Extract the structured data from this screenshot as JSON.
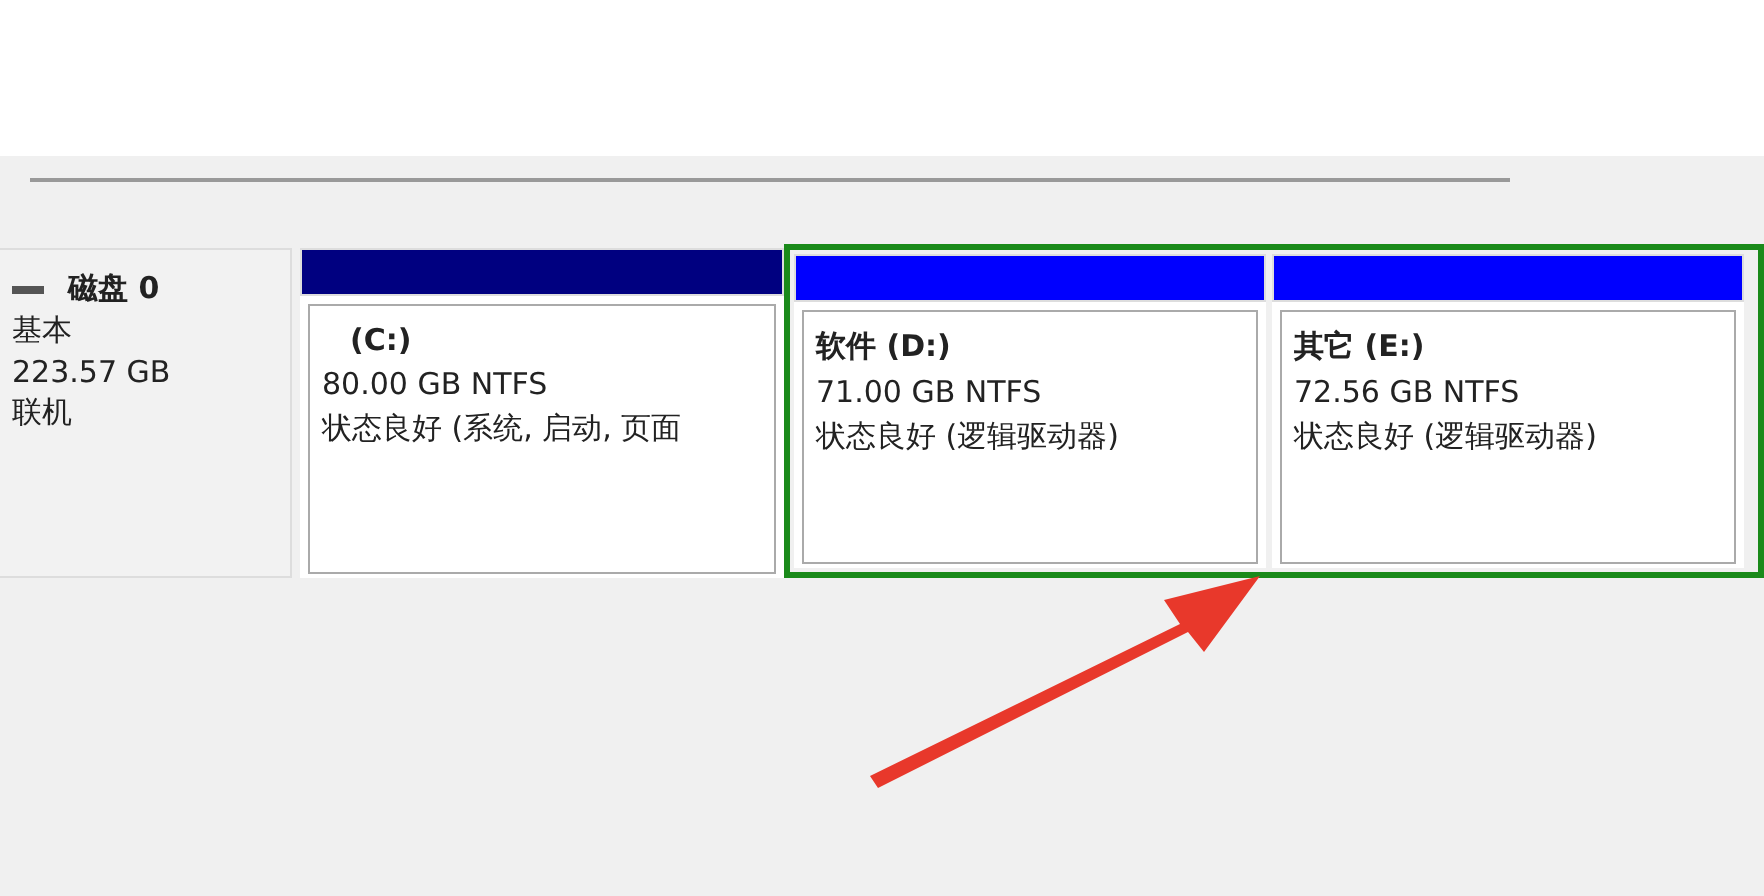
{
  "disk": {
    "name": "磁盘 0",
    "type": "基本",
    "size": "223.57 GB",
    "status": "联机"
  },
  "partitions": [
    {
      "kind": "primary",
      "label": "(C:)",
      "size": "80.00 GB NTFS",
      "status": "状态良好 (系统, 启动, 页面"
    }
  ],
  "extended": {
    "selected": true,
    "partitions": [
      {
        "kind": "logical",
        "label": "软件 (D:)",
        "size": "71.00 GB NTFS",
        "status": "状态良好 (逻辑驱动器)"
      },
      {
        "kind": "logical",
        "label": "其它 (E:)",
        "size": "72.56 GB NTFS",
        "status": "状态良好 (逻辑驱动器)"
      }
    ]
  }
}
